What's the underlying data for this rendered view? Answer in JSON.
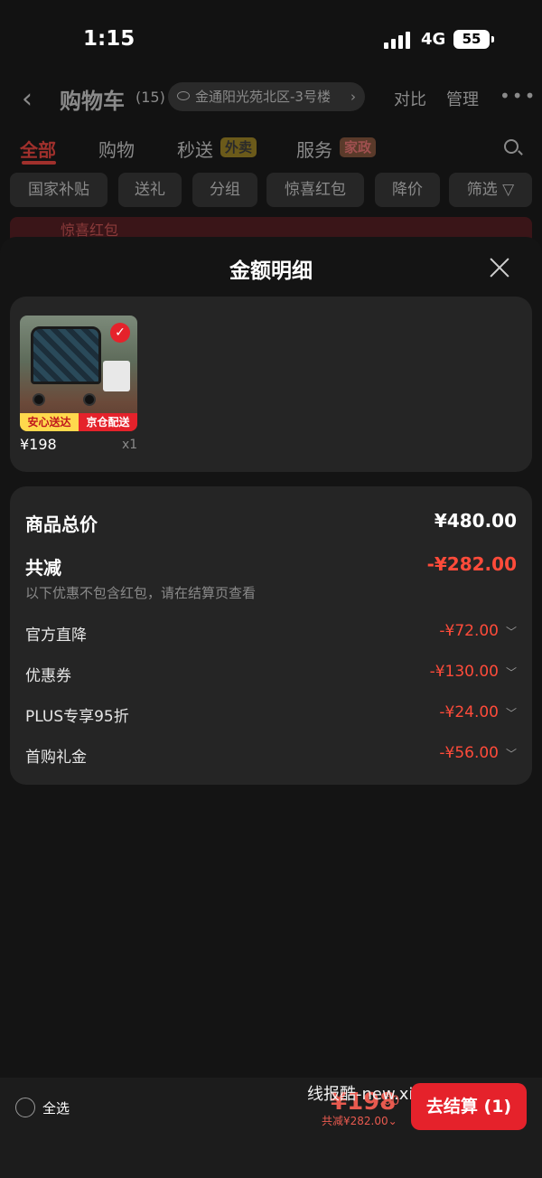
{
  "status_bar": {
    "time": "1:15",
    "network": "4G",
    "battery": "55"
  },
  "nav": {
    "title": "购物车",
    "count": "(15)",
    "address": "金通阳光苑北区-3号楼",
    "compare": "对比",
    "manage": "管理"
  },
  "tabs": [
    {
      "label": "全部"
    },
    {
      "label": "购物"
    },
    {
      "label": "秒送",
      "badge": "外卖"
    },
    {
      "label": "服务",
      "badge": "家政"
    }
  ],
  "chips": [
    "国家补贴",
    "送礼",
    "分组",
    "惊喜红包",
    "降价",
    "筛选"
  ],
  "promo_strip": "惊喜红包",
  "sheet": {
    "title": "金额明细",
    "product": {
      "badge_left": "安心送达",
      "badge_right": "京仓配送",
      "price": "¥198",
      "qty": "x1"
    },
    "details": {
      "total_label": "商品总价",
      "total_value": "¥480.00",
      "reduce_label": "共减",
      "reduce_value": "-¥282.00",
      "note": "以下优惠不包含红包，请在结算页查看",
      "items": [
        {
          "label": "官方直降",
          "value": "-¥72.00"
        },
        {
          "label": "优惠券",
          "value": "-¥130.00"
        },
        {
          "label": "PLUS专享95折",
          "value": "-¥24.00"
        },
        {
          "label": "首购礼金",
          "value": "-¥56.00"
        }
      ]
    }
  },
  "bottom_bar": {
    "select_all": "全选",
    "watermark": "线报酷-new.xianbao.fun",
    "pay_integer": "¥198",
    "pay_decimal": ".00",
    "saved": "共减¥282.00",
    "checkout": "去结算 (1)"
  },
  "colors": {
    "accent": "#e5222b",
    "discount": "#ff4b3a",
    "sheet_bg": "#141414",
    "card_bg": "#252525"
  }
}
